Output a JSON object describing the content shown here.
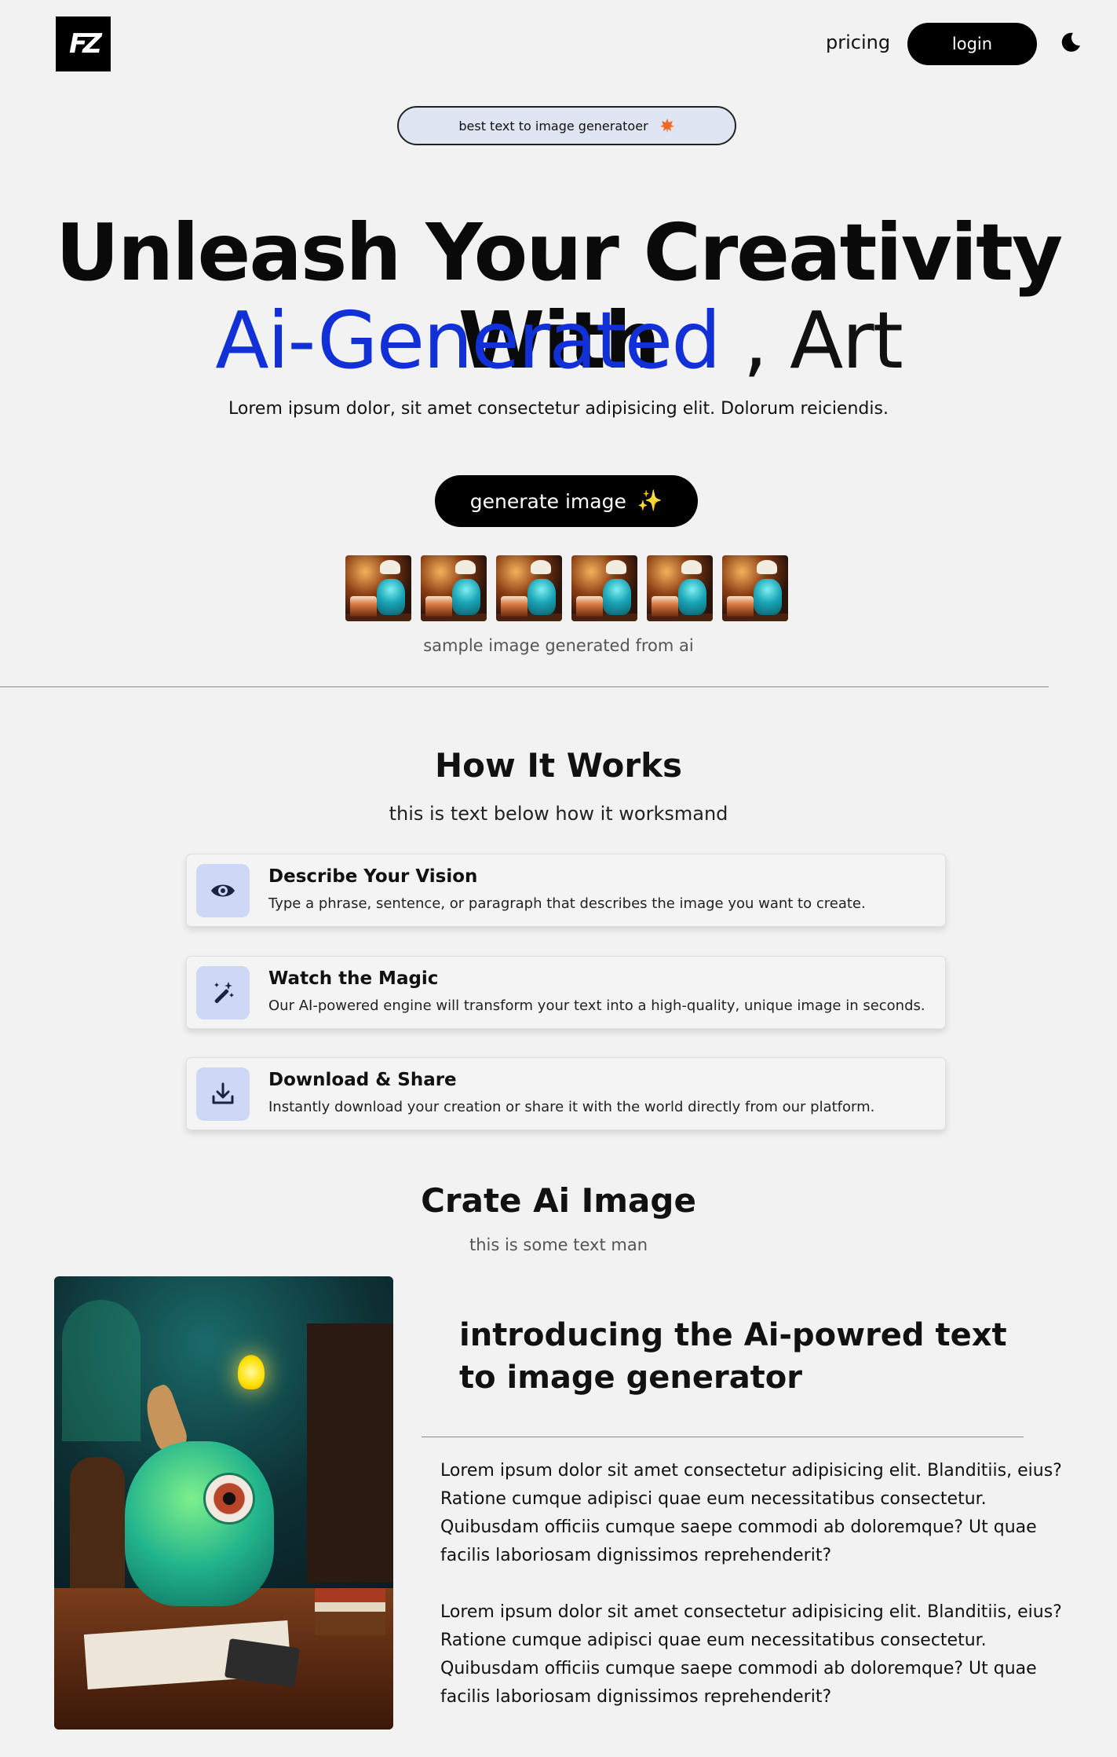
{
  "nav": {
    "logo_text": "FZ",
    "pricing_label": "pricing",
    "login_label": "login",
    "theme_icon": "moon-icon"
  },
  "badge": {
    "text": "best text to image generatoer",
    "icon": "maple-leaf-icon",
    "icon_color": "#f26a21"
  },
  "hero": {
    "title_line1": "Unleash Your Creativity With",
    "title_accent": "Ai-Generated",
    "title_rest": " , Art",
    "accent_color": "#1131d6",
    "subtitle": "Lorem ipsum dolor, sit amet consectetur adipisicing elit. Dolorum reiciendis.",
    "button_label": "generate image",
    "button_icon": "sparkles-icon",
    "thumbnail_count": 6,
    "thumbnails_caption": "sample image generated from ai"
  },
  "how": {
    "title": "How It Works",
    "subtitle": "this is text below how it worksmand",
    "steps": [
      {
        "icon": "eye-icon",
        "title": "Describe Your Vision",
        "desc": "Type a phrase, sentence, or paragraph that describes the image you want to create."
      },
      {
        "icon": "magic-wand-icon",
        "title": "Watch the Magic",
        "desc": "Our AI-powered engine will transform your text into a high-quality, unique image in seconds."
      },
      {
        "icon": "download-icon",
        "title": "Download & Share",
        "desc": "Instantly download your creation or share it with the world directly from our platform."
      }
    ]
  },
  "create": {
    "title": "Crate Ai Image",
    "subtitle": "this is some text man",
    "intro_title": "introducing the Ai-powred text to image generator",
    "paragraph1": "Lorem ipsum dolor sit amet consectetur adipisicing elit. Blanditiis, eius? Ratione cumque adipisci quae eum necessitatibus consectetur. Quibusdam officiis cumque saepe commodi ab doloremque? Ut quae facilis laboriosam dignissimos reprehenderit?",
    "paragraph2": "Lorem ipsum dolor sit amet consectetur adipisicing elit. Blanditiis, eius? Ratione cumque adipisci quae eum necessitatibus consectetur. Quibusdam officiis cumque saepe commodi ab doloremque? Ut quae facilis laboriosam dignissimos reprehenderit?"
  }
}
